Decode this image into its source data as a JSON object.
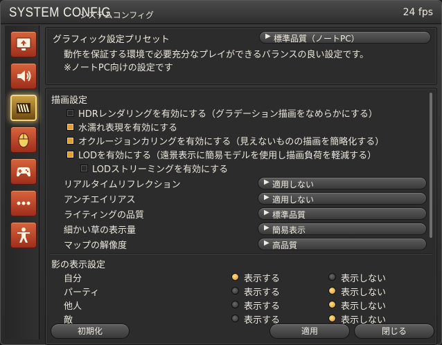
{
  "window": {
    "title": "SYSTEM CONFIG",
    "subtitle": "システムコンフィグ",
    "fps": "24 fps"
  },
  "sidebar": {
    "items": [
      {
        "icon": "display-icon"
      },
      {
        "icon": "speaker-icon"
      },
      {
        "icon": "graphics-icon",
        "active": true
      },
      {
        "icon": "mouse-icon"
      },
      {
        "icon": "gamepad-icon"
      },
      {
        "icon": "more-icon"
      },
      {
        "icon": "character-icon"
      }
    ]
  },
  "preset": {
    "label": "グラフィック設定プリセット",
    "value": "標準品質（ノートPC）",
    "desc1": "動作を保証する環境で必要充分なプレイができるバランスの良い設定です。",
    "desc2": "※ノートPC向けの設定です"
  },
  "render": {
    "heading": "描画設定",
    "options": [
      {
        "label": "HDRレンダリングを有効にする（グラデーション描画をなめらかにする）",
        "checked": false
      },
      {
        "label": "水濡れ表現を有効にする",
        "checked": true
      },
      {
        "label": "オクルージョンカリングを有効にする（見えないものの描画を簡略化する）",
        "checked": true
      },
      {
        "label": "LODを有効にする（遠景表示に簡易モデルを使用し描画負荷を軽減する）",
        "checked": true
      },
      {
        "label": "LODストリーミングを有効にする",
        "checked": false
      }
    ],
    "settings": [
      {
        "label": "リアルタイムリフレクション",
        "value": "適用しない"
      },
      {
        "label": "アンチエイリアス",
        "value": "適用しない"
      },
      {
        "label": "ライティングの品質",
        "value": "標準品質"
      },
      {
        "label": "細かい草の表示量",
        "value": "簡易表示"
      },
      {
        "label": "マップの解像度",
        "value": "高品質"
      }
    ]
  },
  "shadow": {
    "heading": "影の表示設定",
    "show_label": "表示する",
    "hide_label": "表示しない",
    "rows": [
      {
        "label": "自分",
        "selected": "show"
      },
      {
        "label": "パーティ",
        "selected": "hide"
      },
      {
        "label": "他人",
        "selected": "hide"
      },
      {
        "label": "敵",
        "selected": "hide"
      }
    ]
  },
  "footer": {
    "reset": "初期化",
    "apply": "適用",
    "close": "閉じる"
  },
  "colors": {
    "accent": "#e0a030",
    "sidebar_button": "#c04a2c",
    "active_glow": "#f6d680"
  }
}
